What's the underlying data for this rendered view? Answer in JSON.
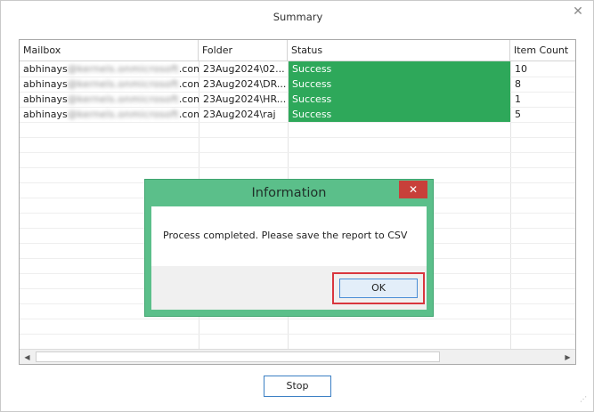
{
  "window": {
    "title": "Summary",
    "close_glyph": "✕",
    "stop_label": "Stop"
  },
  "grid": {
    "columns": [
      "Mailbox",
      "Folder",
      "Status",
      "Item Count"
    ],
    "rows": [
      {
        "mailbox_prefix": "abhinays",
        "mailbox_blurred": "@kernels.onmicrosoft",
        "mailbox_suffix": ".com",
        "folder": "23Aug2024\\02...",
        "status": "Success",
        "count": "10"
      },
      {
        "mailbox_prefix": "abhinays",
        "mailbox_blurred": "@kernels.onmicrosoft",
        "mailbox_suffix": ".com",
        "folder": "23Aug2024\\DR...",
        "status": "Success",
        "count": "8"
      },
      {
        "mailbox_prefix": "abhinays",
        "mailbox_blurred": "@kernels.onmicrosoft",
        "mailbox_suffix": ".com",
        "folder": "23Aug2024\\HR...",
        "status": "Success",
        "count": "1"
      },
      {
        "mailbox_prefix": "abhinays",
        "mailbox_blurred": "@kernels.onmicrosoft",
        "mailbox_suffix": ".com",
        "folder": "23Aug2024\\raj",
        "status": "Success",
        "count": "5"
      }
    ],
    "status_color": "#2ea85a",
    "scroll_left_glyph": "◀",
    "scroll_right_glyph": "▶"
  },
  "dialog": {
    "title": "Information",
    "close_glyph": "✕",
    "message": "Process completed. Please save the report to CSV",
    "ok_label": "OK",
    "frame_color": "#5bbf8a",
    "highlight_color": "#d9363e"
  },
  "icons": {
    "close": "close-icon",
    "scroll_left": "arrow-left-icon",
    "scroll_right": "arrow-right-icon",
    "resize_grip": "resize-grip-icon"
  }
}
